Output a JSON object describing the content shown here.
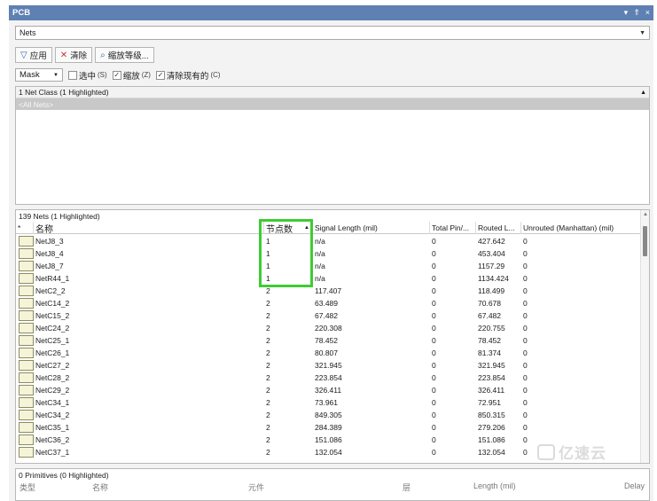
{
  "window": {
    "title": "PCB",
    "controls": [
      "▾",
      "⇑",
      "×"
    ]
  },
  "mode": {
    "selected": "Nets"
  },
  "toolbar": {
    "apply_label": "应用",
    "clear_label": "清除",
    "zoom_label": "缩放等级..."
  },
  "options": {
    "mask_value": "Mask",
    "select": {
      "label": "选中",
      "key": "(S)",
      "checked": false
    },
    "zoom": {
      "label": "缩放",
      "key": "(Z)",
      "checked": true
    },
    "clear_existing": {
      "label": "清除现有的",
      "key": "(C)",
      "checked": true
    }
  },
  "net_class_panel": {
    "header": "1 Net Class (1 Highlighted)",
    "items": [
      "<All Nets>"
    ]
  },
  "nets_panel": {
    "header": "139 Nets (1 Highlighted)",
    "columns": {
      "marker": "*",
      "name": "名称",
      "node_count": "节点数",
      "signal_length": "Signal Length (mil)",
      "total_pin": "Total Pin/...",
      "routed": "Routed L...",
      "unrouted": "Unrouted (Manhattan) (mil)"
    },
    "rows": [
      [
        "NetJ8_3",
        "1",
        "n/a",
        "0",
        "427.642",
        "0"
      ],
      [
        "NetJ8_4",
        "1",
        "n/a",
        "0",
        "453.404",
        "0"
      ],
      [
        "NetJ8_7",
        "1",
        "n/a",
        "0",
        "1157.29",
        "0"
      ],
      [
        "NetR44_1",
        "1",
        "n/a",
        "0",
        "1134.424",
        "0"
      ],
      [
        "NetC2_2",
        "2",
        "117.407",
        "0",
        "118.499",
        "0"
      ],
      [
        "NetC14_2",
        "2",
        "63.489",
        "0",
        "70.678",
        "0"
      ],
      [
        "NetC15_2",
        "2",
        "67.482",
        "0",
        "67.482",
        "0"
      ],
      [
        "NetC24_2",
        "2",
        "220.308",
        "0",
        "220.755",
        "0"
      ],
      [
        "NetC25_1",
        "2",
        "78.452",
        "0",
        "78.452",
        "0"
      ],
      [
        "NetC26_1",
        "2",
        "80.807",
        "0",
        "81.374",
        "0"
      ],
      [
        "NetC27_2",
        "2",
        "321.945",
        "0",
        "321.945",
        "0"
      ],
      [
        "NetC28_2",
        "2",
        "223.854",
        "0",
        "223.854",
        "0"
      ],
      [
        "NetC29_2",
        "2",
        "326.411",
        "0",
        "326.411",
        "0"
      ],
      [
        "NetC34_1",
        "2",
        "73.961",
        "0",
        "72.951",
        "0"
      ],
      [
        "NetC34_2",
        "2",
        "849.305",
        "0",
        "850.315",
        "0"
      ],
      [
        "NetC35_1",
        "2",
        "284.389",
        "0",
        "279.206",
        "0"
      ],
      [
        "NetC36_2",
        "2",
        "151.086",
        "0",
        "151.086",
        "0"
      ],
      [
        "NetC37_1",
        "2",
        "132.054",
        "0",
        "132.054",
        "0"
      ]
    ]
  },
  "primitives_panel": {
    "header": "0 Primitives (0 Highlighted)",
    "columns": [
      "类型",
      "名称",
      "元件",
      "层",
      "Length (mil)",
      "Delay"
    ]
  },
  "watermark": {
    "text": "亿速云"
  },
  "colors": {
    "titlebar": "#5f80b3",
    "highlight": "#3ecc32",
    "swatch": "#f6f4d6"
  }
}
